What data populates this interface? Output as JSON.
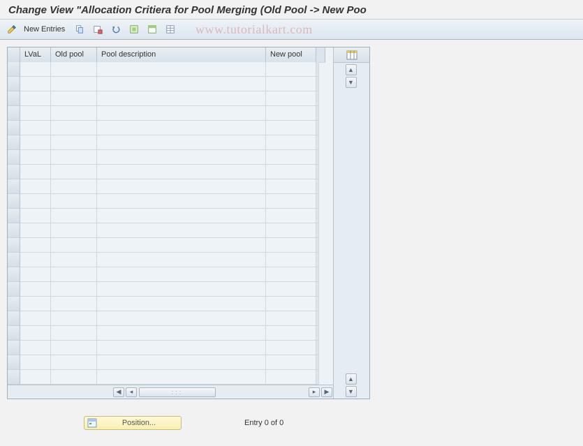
{
  "title": "Change View \"Allocation Critiera for Pool Merging (Old Pool -> New Poo",
  "watermark": "www.tutorialkart.com",
  "toolbar": {
    "new_entries_label": "New Entries"
  },
  "columns": {
    "lval": "LVaL",
    "oldpool": "Old pool",
    "desc": "Pool description",
    "newpool": "New pool"
  },
  "row_count": 22,
  "footer": {
    "position_label": "Position...",
    "entry_text": "Entry 0 of 0"
  }
}
